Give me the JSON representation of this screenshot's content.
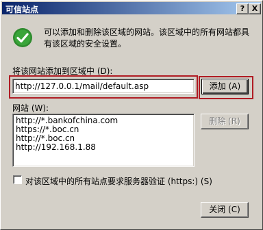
{
  "window": {
    "title": "可信站点",
    "help_button": "?",
    "close_button": "X"
  },
  "info": {
    "icon": "check-icon",
    "description": "可以添加和删除该区域的网站。该区域中的所有网站都具有该区域的安全设置。"
  },
  "add_section": {
    "label": "将该网站添加到区域中 (D):",
    "input_value": "http://127.0.0.1/mail/default.asp",
    "add_button": "添加 (A)"
  },
  "websites": {
    "label": "网站 (W):",
    "items": [
      "http://*.bankofchina.com",
      "https://*.boc.cn",
      "http://*.boc.cn",
      "http://192.168.1.88"
    ],
    "remove_button": "删除 (R)"
  },
  "https_option": {
    "label": "对该区域中的所有站点要求服务器验证 (https:) (S)",
    "checked": false
  },
  "footer": {
    "close_button": "关闭 (C)"
  },
  "colors": {
    "highlight_border": "#b01c24",
    "title_start": "#0a246a",
    "title_end": "#a6caf0",
    "check_green": "#2e8b2e"
  }
}
